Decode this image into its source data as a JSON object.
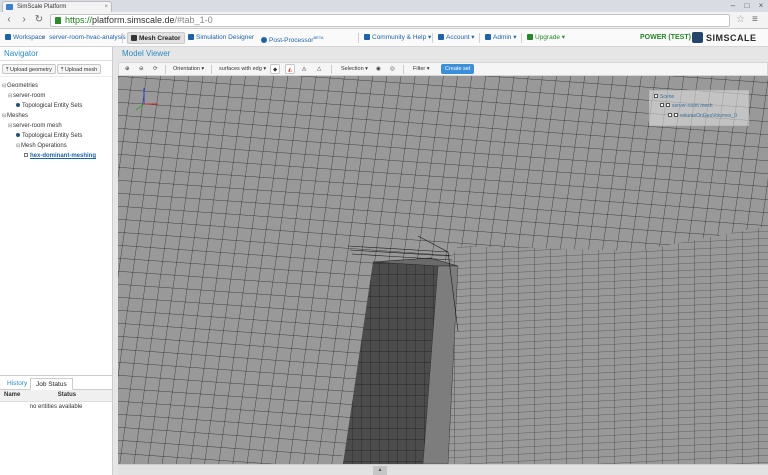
{
  "browser": {
    "tab_title": "SimScale Platform",
    "url_scheme": "https://",
    "url_host": "platform.simscale.de",
    "url_path": "/#tab_1-0"
  },
  "appbar": {
    "workspace": "Workspace",
    "breadcrumb": "server-room-hvac-analysis",
    "mesh_creator": "Mesh Creator",
    "simulation_designer": "Simulation Designer",
    "post_processor": "Post-Processor",
    "beta": "BETA",
    "community": "Community & Help",
    "account": "Account",
    "admin": "Admin",
    "upgrade": "Upgrade",
    "plan": "POWER (TEST)",
    "logo": "SIMSCALE"
  },
  "navigator": {
    "title": "Navigator",
    "upload_geometry": "Upload geometry",
    "upload_mesh": "Upload mesh",
    "geometries": "Geometries",
    "geometry_item": "server-room",
    "topo_sets_1": "Topological Entity Sets",
    "meshes": "Meshes",
    "mesh_item": "server-room mesh",
    "topo_sets_2": "Topological Entity Sets",
    "mesh_operations": "Mesh Operations",
    "operation_item": "hex-dominant-meshing"
  },
  "jobs": {
    "tab_history": "History",
    "tab_status": "Job Status",
    "col_name": "Name",
    "col_status": "Status",
    "empty": "no entities available"
  },
  "viewer": {
    "title": "Model Viewer",
    "orientation": "Orientation",
    "render_mode": "surfaces with edg",
    "selection": "Selection",
    "filter": "Filter",
    "create_set": "Create set",
    "scene_title": "Scene",
    "scene_mesh": "server-room mesh",
    "scene_volume": "volumeOnGeoVolumes_0"
  }
}
